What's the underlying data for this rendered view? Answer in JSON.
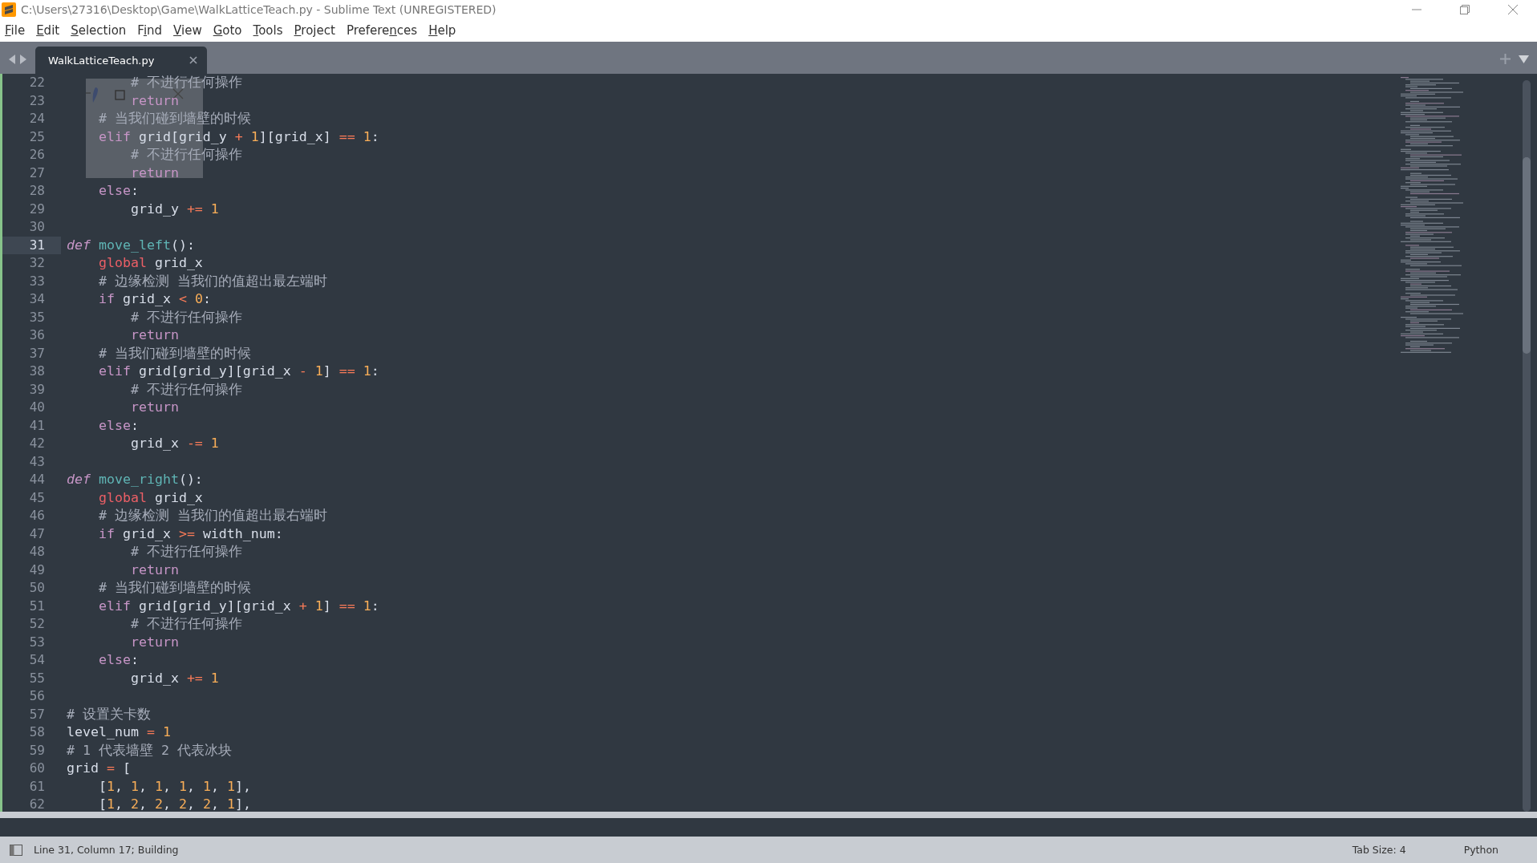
{
  "window": {
    "title": "C:\\Users\\27316\\Desktop\\Game\\WalkLatticeTeach.py - Sublime Text (UNREGISTERED)"
  },
  "menu": [
    {
      "key": "F",
      "post": "ile"
    },
    {
      "key": "E",
      "post": "dit"
    },
    {
      "key": "S",
      "post": "election"
    },
    {
      "pre": "F",
      "key": "i",
      "post": "nd"
    },
    {
      "key": "V",
      "post": "iew"
    },
    {
      "key": "G",
      "post": "oto"
    },
    {
      "key": "T",
      "post": "ools"
    },
    {
      "key": "P",
      "post": "roject"
    },
    {
      "pre": "Prefere",
      "key": "n",
      "post": "ces"
    },
    {
      "key": "H",
      "post": "elp"
    }
  ],
  "tabs": [
    {
      "label": "WalkLatticeTeach.py",
      "selected": true
    }
  ],
  "lines": [
    {
      "number": "22",
      "current": false,
      "tokens": [
        {
          "kind": "com",
          "t": "        # 不进行任何操作"
        }
      ]
    },
    {
      "number": "23",
      "current": false,
      "tokens": [
        {
          "kind": "kw",
          "t": "        return"
        }
      ]
    },
    {
      "number": "24",
      "current": false,
      "tokens": [
        {
          "kind": "com",
          "t": "    # 当我们碰到墙壁的时候"
        }
      ]
    },
    {
      "number": "25",
      "current": false,
      "tokens": [
        {
          "kind": "kw",
          "t": "    elif"
        },
        {
          "kind": "txt",
          "t": " grid[grid_y "
        },
        {
          "kind": "op",
          "t": "+"
        },
        {
          "kind": "num",
          "t": " 1"
        },
        {
          "kind": "txt",
          "t": "][grid_x] "
        },
        {
          "kind": "op",
          "t": "=="
        },
        {
          "kind": "num",
          "t": " 1"
        },
        {
          "kind": "txt",
          "t": ":"
        }
      ]
    },
    {
      "number": "26",
      "current": false,
      "tokens": [
        {
          "kind": "com",
          "t": "        # 不进行任何操作"
        }
      ]
    },
    {
      "number": "27",
      "current": false,
      "tokens": [
        {
          "kind": "kw",
          "t": "        return"
        }
      ]
    },
    {
      "number": "28",
      "current": false,
      "tokens": [
        {
          "kind": "kw",
          "t": "    else"
        },
        {
          "kind": "txt",
          "t": ":"
        }
      ]
    },
    {
      "number": "29",
      "current": false,
      "tokens": [
        {
          "kind": "txt",
          "t": "        grid_y "
        },
        {
          "kind": "op",
          "t": "+="
        },
        {
          "kind": "num",
          "t": " 1"
        }
      ]
    },
    {
      "number": "30",
      "current": false
    },
    {
      "number": "31",
      "current": true,
      "tokens": [
        {
          "kind": "def",
          "t": "def"
        },
        {
          "kind": "fn",
          "t": " move_left"
        },
        {
          "kind": "txt",
          "t": "():"
        }
      ]
    },
    {
      "number": "32",
      "current": false,
      "tokens": [
        {
          "kind": "glob",
          "t": "    global"
        },
        {
          "kind": "txt",
          "t": " grid_x"
        }
      ]
    },
    {
      "number": "33",
      "current": false,
      "tokens": [
        {
          "kind": "com",
          "t": "    # 边缘检测 当我们的值超出最左端时"
        }
      ]
    },
    {
      "number": "34",
      "current": false,
      "tokens": [
        {
          "kind": "kw",
          "t": "    if"
        },
        {
          "kind": "txt",
          "t": " grid_x "
        },
        {
          "kind": "op",
          "t": "<"
        },
        {
          "kind": "num",
          "t": " 0"
        },
        {
          "kind": "txt",
          "t": ":"
        }
      ]
    },
    {
      "number": "35",
      "current": false,
      "tokens": [
        {
          "kind": "com",
          "t": "        # 不进行任何操作"
        }
      ]
    },
    {
      "number": "36",
      "current": false,
      "tokens": [
        {
          "kind": "kw",
          "t": "        return"
        }
      ]
    },
    {
      "number": "37",
      "current": false,
      "tokens": [
        {
          "kind": "com",
          "t": "    # 当我们碰到墙壁的时候"
        }
      ]
    },
    {
      "number": "38",
      "current": false,
      "tokens": [
        {
          "kind": "kw",
          "t": "    elif"
        },
        {
          "kind": "txt",
          "t": " grid[grid_y][grid_x "
        },
        {
          "kind": "op",
          "t": "-"
        },
        {
          "kind": "num",
          "t": " 1"
        },
        {
          "kind": "txt",
          "t": "] "
        },
        {
          "kind": "op",
          "t": "=="
        },
        {
          "kind": "num",
          "t": " 1"
        },
        {
          "kind": "txt",
          "t": ":"
        }
      ]
    },
    {
      "number": "39",
      "current": false,
      "tokens": [
        {
          "kind": "com",
          "t": "        # 不进行任何操作"
        }
      ]
    },
    {
      "number": "40",
      "current": false,
      "tokens": [
        {
          "kind": "kw",
          "t": "        return"
        }
      ]
    },
    {
      "number": "41",
      "current": false,
      "tokens": [
        {
          "kind": "kw",
          "t": "    else"
        },
        {
          "kind": "txt",
          "t": ":"
        }
      ]
    },
    {
      "number": "42",
      "current": false,
      "tokens": [
        {
          "kind": "txt",
          "t": "        grid_x "
        },
        {
          "kind": "op",
          "t": "-="
        },
        {
          "kind": "num",
          "t": " 1"
        }
      ]
    },
    {
      "number": "43",
      "current": false
    },
    {
      "number": "44",
      "current": false,
      "tokens": [
        {
          "kind": "def",
          "t": "def"
        },
        {
          "kind": "fn",
          "t": " move_right"
        },
        {
          "kind": "txt",
          "t": "():"
        }
      ]
    },
    {
      "number": "45",
      "current": false,
      "tokens": [
        {
          "kind": "glob",
          "t": "    global"
        },
        {
          "kind": "txt",
          "t": " grid_x"
        }
      ]
    },
    {
      "number": "46",
      "current": false,
      "tokens": [
        {
          "kind": "com",
          "t": "    # 边缘检测 当我们的值超出最右端时"
        }
      ]
    },
    {
      "number": "47",
      "current": false,
      "tokens": [
        {
          "kind": "kw",
          "t": "    if"
        },
        {
          "kind": "txt",
          "t": " grid_x "
        },
        {
          "kind": "op",
          "t": ">="
        },
        {
          "kind": "txt",
          "t": " width_num:"
        }
      ]
    },
    {
      "number": "48",
      "current": false,
      "tokens": [
        {
          "kind": "com",
          "t": "        # 不进行任何操作"
        }
      ]
    },
    {
      "number": "49",
      "current": false,
      "tokens": [
        {
          "kind": "kw",
          "t": "        return"
        }
      ]
    },
    {
      "number": "50",
      "current": false,
      "tokens": [
        {
          "kind": "com",
          "t": "    # 当我们碰到墙壁的时候"
        }
      ]
    },
    {
      "number": "51",
      "current": false,
      "tokens": [
        {
          "kind": "kw",
          "t": "    elif"
        },
        {
          "kind": "txt",
          "t": " grid[grid_y][grid_x "
        },
        {
          "kind": "op",
          "t": "+"
        },
        {
          "kind": "num",
          "t": " 1"
        },
        {
          "kind": "txt",
          "t": "] "
        },
        {
          "kind": "op",
          "t": "=="
        },
        {
          "kind": "num",
          "t": " 1"
        },
        {
          "kind": "txt",
          "t": ":"
        }
      ]
    },
    {
      "number": "52",
      "current": false,
      "tokens": [
        {
          "kind": "com",
          "t": "        # 不进行任何操作"
        }
      ]
    },
    {
      "number": "53",
      "current": false,
      "tokens": [
        {
          "kind": "kw",
          "t": "        return"
        }
      ]
    },
    {
      "number": "54",
      "current": false,
      "tokens": [
        {
          "kind": "kw",
          "t": "    else"
        },
        {
          "kind": "txt",
          "t": ":"
        }
      ]
    },
    {
      "number": "55",
      "current": false,
      "tokens": [
        {
          "kind": "txt",
          "t": "        grid_x "
        },
        {
          "kind": "op",
          "t": "+="
        },
        {
          "kind": "num",
          "t": " 1"
        }
      ]
    },
    {
      "number": "56",
      "current": false
    },
    {
      "number": "57",
      "current": false,
      "tokens": [
        {
          "kind": "com",
          "t": "# 设置关卡数"
        }
      ]
    },
    {
      "number": "58",
      "current": false,
      "tokens": [
        {
          "kind": "txt",
          "t": "level_num "
        },
        {
          "kind": "op",
          "t": "="
        },
        {
          "kind": "num",
          "t": " 1"
        }
      ]
    },
    {
      "number": "59",
      "current": false,
      "tokens": [
        {
          "kind": "com",
          "t": "# 1 代表墙壁 2 代表冰块"
        }
      ]
    },
    {
      "number": "60",
      "current": false,
      "tokens": [
        {
          "kind": "txt",
          "t": "grid "
        },
        {
          "kind": "op",
          "t": "="
        },
        {
          "kind": "txt",
          "t": " ["
        }
      ]
    },
    {
      "number": "61",
      "current": false,
      "tokens": [
        {
          "kind": "txt",
          "t": "    ["
        },
        {
          "kind": "num",
          "t": "1"
        },
        {
          "kind": "txt",
          "t": ", "
        },
        {
          "kind": "num",
          "t": "1"
        },
        {
          "kind": "txt",
          "t": ", "
        },
        {
          "kind": "num",
          "t": "1"
        },
        {
          "kind": "txt",
          "t": ", "
        },
        {
          "kind": "num",
          "t": "1"
        },
        {
          "kind": "txt",
          "t": ", "
        },
        {
          "kind": "num",
          "t": "1"
        },
        {
          "kind": "txt",
          "t": ", "
        },
        {
          "kind": "num",
          "t": "1"
        },
        {
          "kind": "txt",
          "t": "],"
        }
      ]
    },
    {
      "number": "62",
      "current": false,
      "tokens": [
        {
          "kind": "txt",
          "t": "    ["
        },
        {
          "kind": "num",
          "t": "1"
        },
        {
          "kind": "txt",
          "t": ", "
        },
        {
          "kind": "num",
          "t": "2"
        },
        {
          "kind": "txt",
          "t": ", "
        },
        {
          "kind": "num",
          "t": "2"
        },
        {
          "kind": "txt",
          "t": ", "
        },
        {
          "kind": "num",
          "t": "2"
        },
        {
          "kind": "txt",
          "t": ", "
        },
        {
          "kind": "num",
          "t": "2"
        },
        {
          "kind": "txt",
          "t": ", "
        },
        {
          "kind": "num",
          "t": "1"
        },
        {
          "kind": "txt",
          "t": "],"
        }
      ]
    }
  ],
  "status_bar": {
    "position": "Line 31, Column 17; Building",
    "tab_size": "Tab Size: 4",
    "syntax": "Python"
  }
}
